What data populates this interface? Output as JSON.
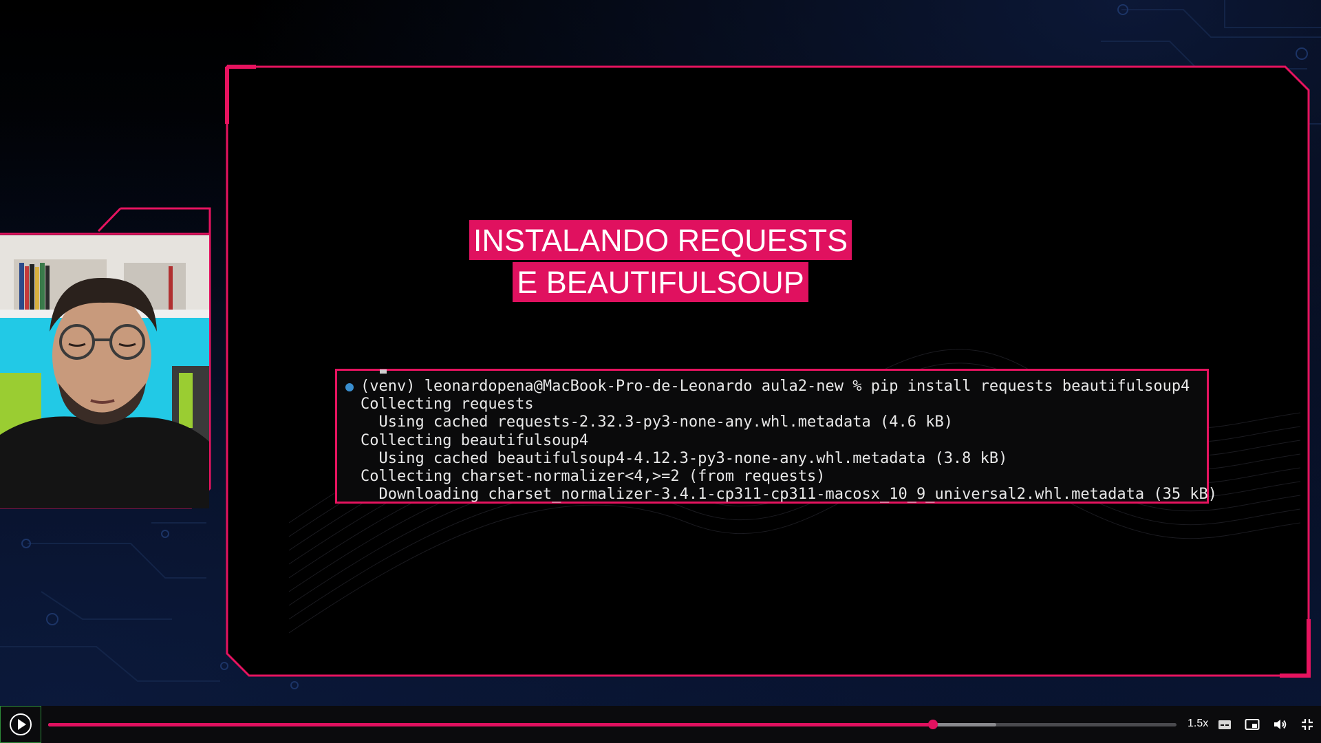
{
  "slide": {
    "title_line1": "INSTALANDO REQUESTS",
    "title_line2": "E BEAUTIFULSOUP"
  },
  "terminal": {
    "lines": [
      "(venv) leonardopena@MacBook-Pro-de-Leonardo aula2-new % pip install requests beautifulsoup4",
      "Collecting requests",
      "  Using cached requests-2.32.3-py3-none-any.whl.metadata (4.6 kB)",
      "Collecting beautifulsoup4",
      "  Using cached beautifulsoup4-4.12.3-py3-none-any.whl.metadata (3.8 kB)",
      "Collecting charset-normalizer<4,>=2 (from requests)",
      "  Downloading charset_normalizer-3.4.1-cp311-cp311-macosx_10_9_universal2.whl.metadata (35 kB)"
    ]
  },
  "player": {
    "speed_label": "1.5x",
    "progress_fraction": 0.784,
    "buffered_fraction": 0.84,
    "icons": [
      "play-icon",
      "captions-icon",
      "picture-in-picture-icon",
      "volume-icon",
      "exit-fullscreen-icon"
    ]
  },
  "colors": {
    "accent": "#e0115f",
    "frame": "#e6135f",
    "background": "#02040a"
  }
}
